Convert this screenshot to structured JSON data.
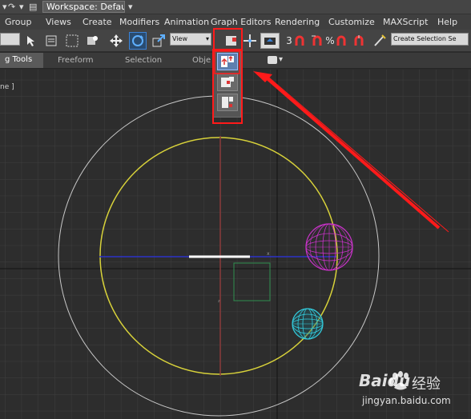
{
  "titlebar": {
    "workspace_label": "Workspace: Default",
    "redo_icon": "redo-icon",
    "file_icon": "file-icon",
    "dropdown_icon": "chevron-down-icon"
  },
  "menubar": {
    "items": [
      "Group",
      "Views",
      "Create",
      "Modifiers",
      "Animation",
      "Graph Editors",
      "Rendering",
      "Customize",
      "MAXScript",
      "Help"
    ]
  },
  "toolbar": {
    "reference_coord_value": "View",
    "named_selection_value": "Create Selection Se",
    "snaps_label": "3",
    "percent_snap_label": "%"
  },
  "ribbon": {
    "tabs": [
      "g Tools",
      "Freeform",
      "Selection",
      "Obje"
    ]
  },
  "viewport": {
    "label": "ne ]",
    "axis_label": "x"
  },
  "watermark": {
    "brand": "Baidu",
    "brand_cn": "经验",
    "url": "jingyan.baidu.com"
  },
  "colors": {
    "highlight": "#ff1a1a",
    "orbit": "#d8d23a",
    "outer_circle": "#c8c8c8",
    "grid": "#3d3d3d",
    "sphere_magenta": "#cc33cc",
    "sphere_cyan": "#33ccdd",
    "active_tool": "#3b82d6"
  }
}
